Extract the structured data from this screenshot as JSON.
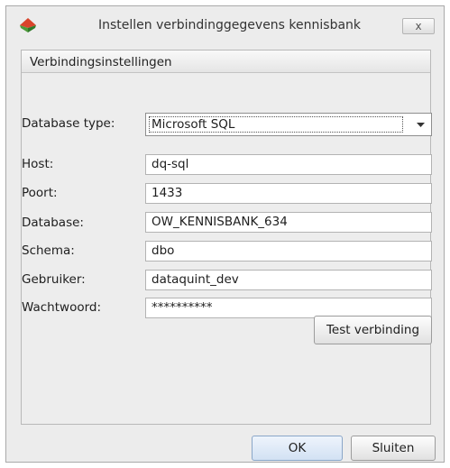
{
  "window": {
    "title": "Instellen verbindinggegevens kennisbank",
    "close_label": "x",
    "icon": "app-logo-icon"
  },
  "group": {
    "title": "Verbindingsinstellingen"
  },
  "form": {
    "database_type": {
      "label": "Database type:",
      "value": "Microsoft SQL",
      "arrow_icon": "dropdown-arrow-icon"
    },
    "host": {
      "label": "Host:",
      "value": "dq-sql"
    },
    "port": {
      "label": "Poort:",
      "value": "1433"
    },
    "database": {
      "label": "Database:",
      "value": "OW_KENNISBANK_634"
    },
    "schema": {
      "label": "Schema:",
      "value": "dbo"
    },
    "user": {
      "label": "Gebruiker:",
      "value": "dataquint_dev"
    },
    "password": {
      "label": "Wachtwoord:",
      "value": "**********"
    }
  },
  "buttons": {
    "test": "Test verbinding",
    "ok": "OK",
    "close": "Sluiten"
  },
  "colors": {
    "logo_red": "#d9442b",
    "logo_green": "#4e9b3a",
    "ok_accent": "#d2e1f3"
  }
}
